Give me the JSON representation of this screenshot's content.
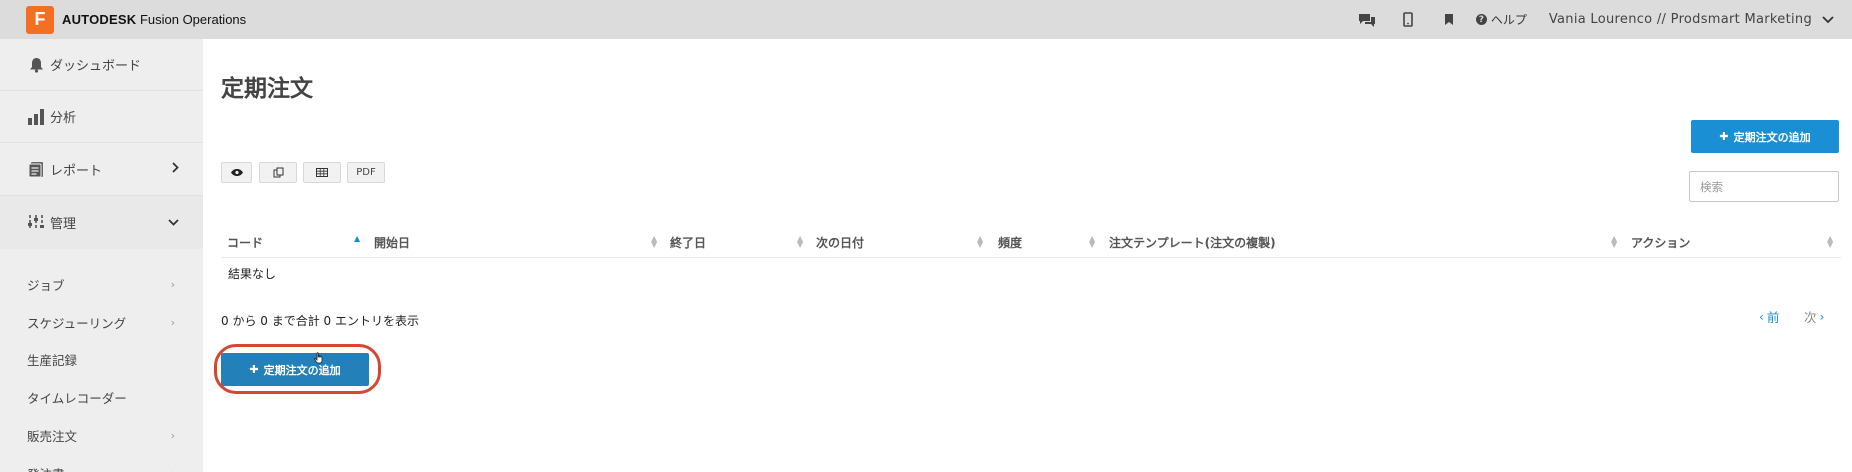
{
  "header": {
    "logo_letter": "F",
    "brand_bold": "AUTODESK",
    "brand_rest": "Fusion Operations",
    "icons": [
      "chat-icon",
      "mobile-icon",
      "bookmark-icon"
    ],
    "help_label": "ヘルプ",
    "user_label": "Vania Lourenco // Prodsmart Marketing",
    "accent_color": "#f37023"
  },
  "sidebar": {
    "items": [
      {
        "label": "ダッシュボード",
        "icon": "bell-icon"
      },
      {
        "label": "分析",
        "icon": "bar-chart-icon"
      },
      {
        "label": "レポート",
        "icon": "report-icon"
      },
      {
        "label": "管理",
        "icon": "sliders-icon"
      }
    ],
    "sub_items": [
      {
        "label": "ジョブ"
      },
      {
        "label": "スケジューリング"
      },
      {
        "label": "生産記録"
      },
      {
        "label": "タイムレコーダー"
      },
      {
        "label": "販売注文"
      },
      {
        "label": "発注書"
      }
    ]
  },
  "main": {
    "title": "定期注文",
    "add_button_label": "定期注文の追加",
    "toolbar": {
      "pdf_label": "PDF"
    },
    "search_placeholder": "検索",
    "columns": [
      "コード",
      "開始日",
      "終了日",
      "次の日付",
      "頻度",
      "注文テンプレート(注文の複製)",
      "アクション"
    ],
    "no_results": "結果なし",
    "entries_info": "0 から 0 まで合計 0 エントリを表示",
    "pager": {
      "prev": "前",
      "next": "次"
    },
    "primary_color": "#1b8fd4",
    "highlight_color": "#d9452e"
  }
}
